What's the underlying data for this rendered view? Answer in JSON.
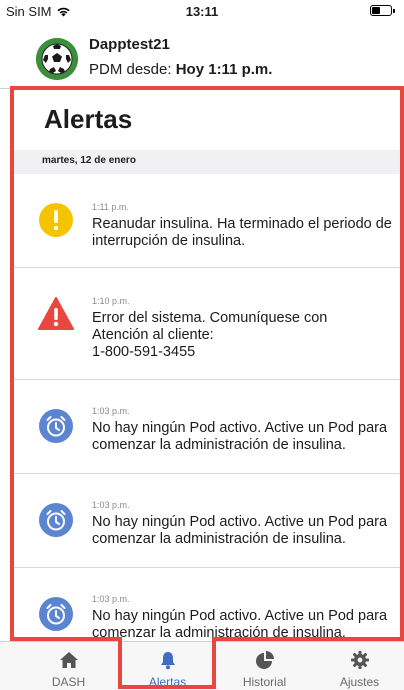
{
  "status_bar": {
    "carrier": "Sin SIM",
    "time": "13:11"
  },
  "header": {
    "user_name": "Dapptest21",
    "pdm_prefix": "PDM desde:",
    "pdm_value": "Hoy 1:11 p.m."
  },
  "page_title": "Alertas",
  "date_section": "martes, 12 de enero",
  "alerts": [
    {
      "time": "1:11 p.m.",
      "message": "Reanudar insulina. Ha terminado el periodo de interrupción de insulina.",
      "icon": "warning-circle-icon"
    },
    {
      "time": "1:10 p.m.",
      "message": "Error del sistema. Comuníquese con Atención al cliente:\n1-800-591-3455",
      "icon": "error-triangle-icon"
    },
    {
      "time": "1:03 p.m.",
      "message": "No hay ningún Pod activo. Active un Pod para comenzar la administración de insulina.",
      "icon": "alarm-clock-icon"
    },
    {
      "time": "1:03 p.m.",
      "message": "No hay ningún Pod activo. Active un Pod para comenzar la administración de insulina.",
      "icon": "alarm-clock-icon"
    },
    {
      "time": "1:03 p.m.",
      "message": "No hay ningún Pod activo. Active un Pod para comenzar la administración de insulina.",
      "icon": "alarm-clock-icon"
    }
  ],
  "tabs": [
    {
      "label": "DASH",
      "icon": "home-icon"
    },
    {
      "label": "Alertas",
      "icon": "bell-icon",
      "active": true
    },
    {
      "label": "Historial",
      "icon": "pie-chart-icon"
    },
    {
      "label": "Ajustes",
      "icon": "gear-icon"
    }
  ],
  "colors": {
    "warning": "#f5c400",
    "error": "#e8473f",
    "notification": "#5b86cf",
    "tab_active": "#3f6dc2",
    "highlight_outline": "#e8473f"
  }
}
